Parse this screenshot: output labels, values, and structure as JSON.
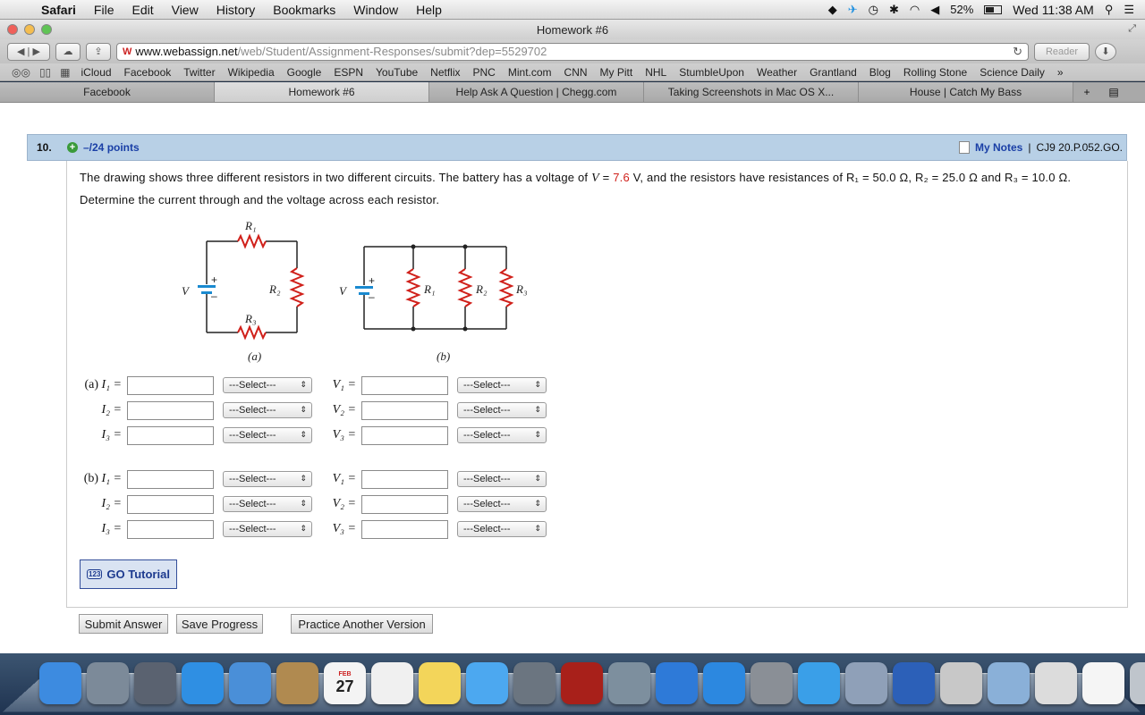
{
  "menubar": {
    "app": "Safari",
    "items": [
      "File",
      "Edit",
      "View",
      "History",
      "Bookmarks",
      "Window",
      "Help"
    ],
    "battery": "52%",
    "clock": "Wed 11:38 AM"
  },
  "window": {
    "title": "Homework #6"
  },
  "toolbar": {
    "url_domain": "www.webassign.net",
    "url_path": "/web/Student/Assignment-Responses/submit?dep=5529702",
    "reader_label": "Reader"
  },
  "bookmarks": [
    "iCloud",
    "Facebook",
    "Twitter",
    "Wikipedia",
    "Google",
    "ESPN",
    "YouTube",
    "Netflix",
    "PNC",
    "Mint.com",
    "CNN",
    "My Pitt",
    "NHL",
    "StumbleUpon",
    "Weather",
    "Grantland",
    "Blog",
    "Rolling Stone",
    "Science Daily"
  ],
  "tabs": [
    {
      "label": "Facebook"
    },
    {
      "label": "Homework #6"
    },
    {
      "label": "Help Ask A Question | Chegg.com"
    },
    {
      "label": "Taking Screenshots in Mac OS X..."
    },
    {
      "label": "House | Catch My Bass"
    }
  ],
  "question": {
    "number": "10.",
    "points": "–/24 points",
    "my_notes": "My Notes",
    "separator": "|",
    "code": "CJ9 20.P.052.GO.",
    "text_1": "The drawing shows three different resistors in two different circuits. The battery has a voltage of ",
    "v_symbol": "V",
    "eq": " = ",
    "v_value": "7.6",
    "text_2": " V, and the resistors have resistances of ",
    "r1_text": "R₁ = 50.0 Ω, ",
    "r2_text": "R₂ = 25.0 Ω",
    "text_3": " and ",
    "r3_text": "R₃ = 10.0 Ω",
    "text_4": ". Determine the current through and the voltage across each resistor."
  },
  "figure": {
    "a_label": "(a)",
    "b_label": "(b)",
    "v": "V",
    "plus": "+",
    "minus": "–",
    "r1": "R₁",
    "r2": "R₂",
    "r3": "R₃"
  },
  "answers": {
    "a_prefix": "(a)",
    "b_prefix": "(b)",
    "i1": "I₁ =",
    "i2": "I₂ =",
    "i3": "I₃ =",
    "v1": "V₁ =",
    "v2": "V₂ =",
    "v3": "V₃ =",
    "select_placeholder": "---Select---"
  },
  "buttons": {
    "tutorial": "GO Tutorial",
    "tutorial_icon": "123",
    "submit": "Submit Answer",
    "save": "Save Progress",
    "practice": "Practice Another Version"
  },
  "dock": {
    "icons": [
      "finder-icon",
      "launchpad-icon",
      "photo-browser-icon",
      "safari-icon",
      "mail-icon",
      "contacts-icon",
      "calendar-icon",
      "reminders-icon",
      "notes-icon",
      "messages-icon",
      "facetime-icon",
      "photo-booth-icon",
      "iphoto-icon",
      "itunes-icon",
      "app-store-icon",
      "system-preferences-icon",
      "twitter-icon",
      "script-editor-icon",
      "keynote-icon",
      "calculator-icon",
      "documents-folder-icon",
      "downloads-folder-icon",
      "text-edit-icon",
      "trash-icon"
    ],
    "calendar_day": "27",
    "calendar_month": "FEB"
  }
}
